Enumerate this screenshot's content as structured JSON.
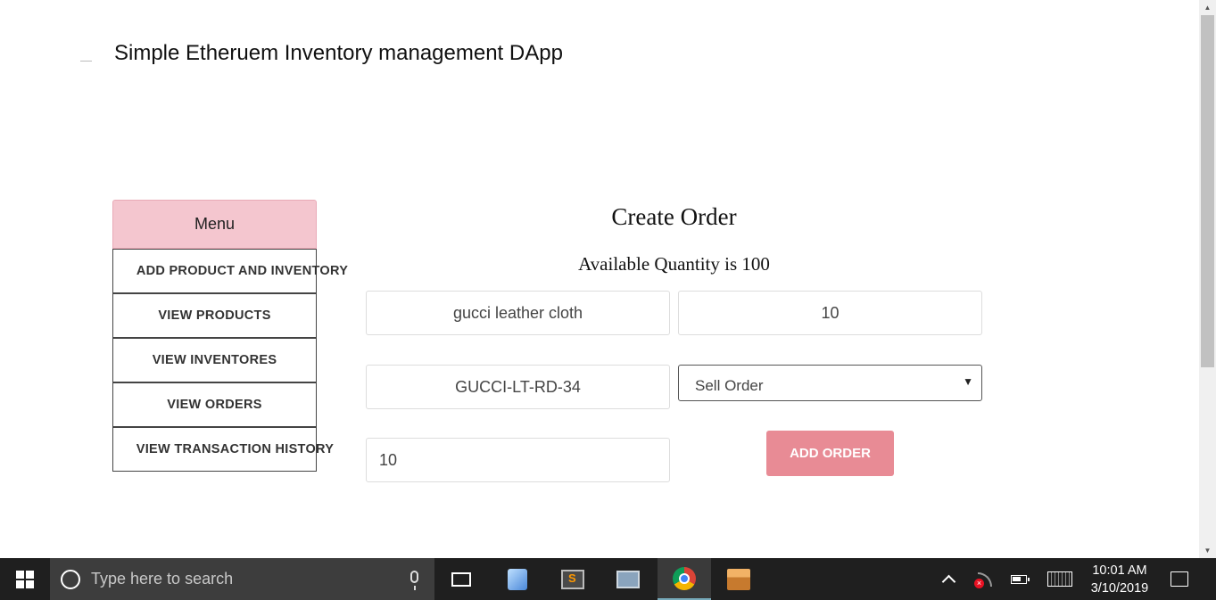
{
  "app": {
    "title": "Simple Etheruem Inventory management DApp"
  },
  "menu": {
    "header": "Menu",
    "items": [
      {
        "label": "ADD PRODUCT AND INVENTORY"
      },
      {
        "label": "VIEW PRODUCTS"
      },
      {
        "label": "VIEW INVENTORES"
      },
      {
        "label": "VIEW ORDERS"
      },
      {
        "label": "VIEW TRANSACTION HISTORY"
      }
    ]
  },
  "order": {
    "title": "Create Order",
    "available": "Available Quantity is 100",
    "product_name": "gucci leather cloth",
    "quantity_field": "10",
    "sku": "GUCCI-LT-RD-34",
    "order_type": "Sell Order",
    "amount": "10",
    "submit_label": "ADD ORDER"
  },
  "colors": {
    "menu_header_bg": "#f4c6cf",
    "add_button_bg": "#e88b95",
    "taskbar_bg": "#1f1f1f"
  },
  "taskbar": {
    "search_placeholder": "Type here to search",
    "time": "10:01 AM",
    "date": "3/10/2019",
    "icons": [
      "task-view-icon",
      "virtualbox-icon",
      "sublime-text-icon",
      "task-manager-icon",
      "chrome-icon",
      "minecraft-icon"
    ],
    "tray_icons": [
      "show-hidden-icons-chevron",
      "network-disconnected-icon",
      "battery-icon",
      "touch-keyboard-icon",
      "action-center-icon"
    ]
  }
}
